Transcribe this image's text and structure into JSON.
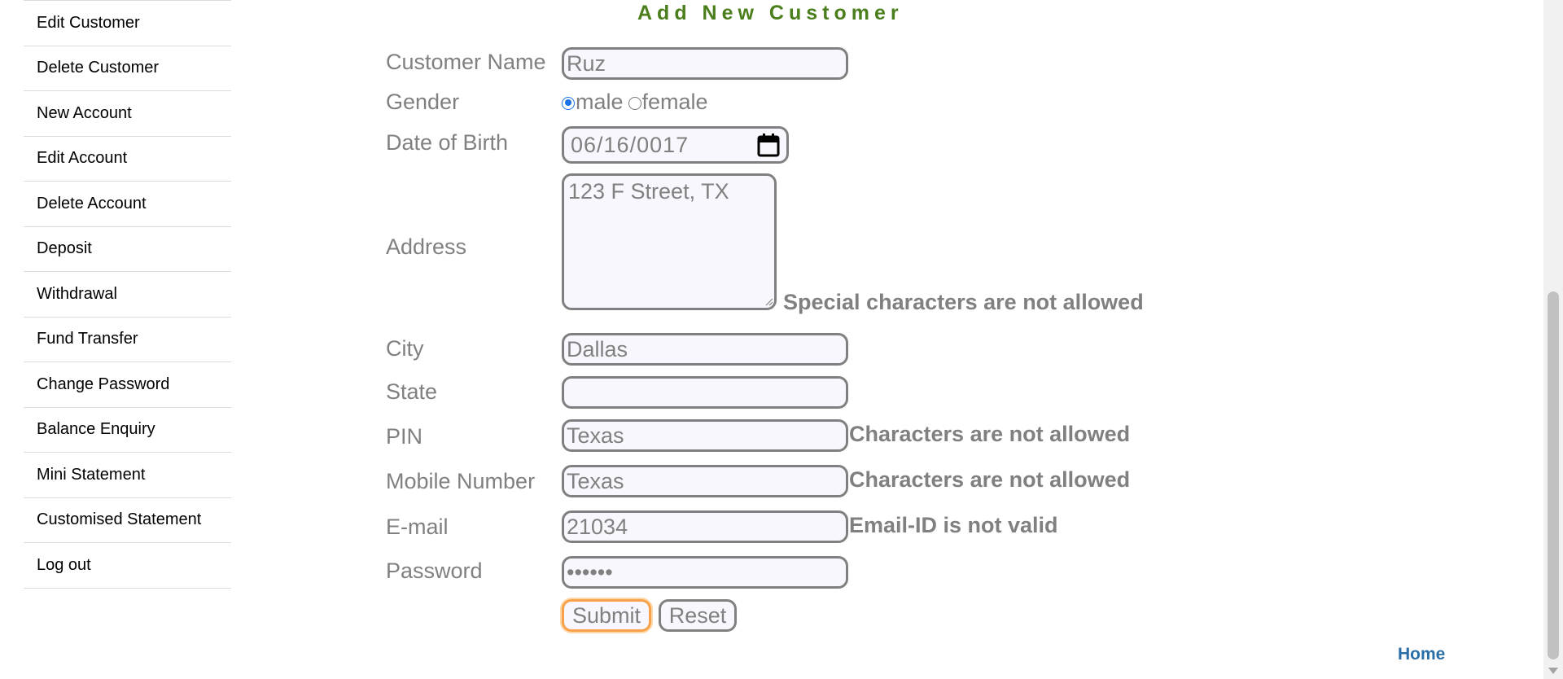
{
  "sidebar": {
    "items": [
      {
        "label": "Edit Customer"
      },
      {
        "label": "Delete Customer"
      },
      {
        "label": "New Account"
      },
      {
        "label": "Edit Account"
      },
      {
        "label": "Delete Account"
      },
      {
        "label": "Deposit"
      },
      {
        "label": "Withdrawal"
      },
      {
        "label": "Fund Transfer"
      },
      {
        "label": "Change Password"
      },
      {
        "label": "Balance Enquiry"
      },
      {
        "label": "Mini Statement"
      },
      {
        "label": "Customised Statement"
      },
      {
        "label": "Log out"
      }
    ]
  },
  "form": {
    "title": "Add New Customer",
    "fields": {
      "customer_name": {
        "label": "Customer Name",
        "value": "Ruz"
      },
      "gender": {
        "label": "Gender",
        "options": [
          "male",
          "female"
        ],
        "selected": "male"
      },
      "dob": {
        "label": "Date of Birth",
        "value": "06/16/0017"
      },
      "address": {
        "label": "Address",
        "value": "123 F Street, TX",
        "error": "Special characters are not allowed"
      },
      "city": {
        "label": "City",
        "value": "Dallas"
      },
      "state": {
        "label": "State",
        "value": ""
      },
      "pin": {
        "label": "PIN",
        "value": "Texas",
        "error": "Characters are not allowed"
      },
      "mobile": {
        "label": "Mobile Number",
        "value": "Texas",
        "error": "Characters are not allowed"
      },
      "email": {
        "label": "E-mail",
        "value": "21034",
        "error": "Email-ID is not valid"
      },
      "password": {
        "label": "Password",
        "value": "••••••"
      }
    },
    "buttons": {
      "submit_label": "Submit",
      "reset_label": "Reset"
    }
  },
  "footer": {
    "home_link": "Home"
  },
  "icons": {
    "calendar": "calendar-icon"
  },
  "colors": {
    "title": "#4b7e1c",
    "label": "#808080",
    "link": "#2a6fa8",
    "submit_focus": "#f7a24b",
    "radio_selected": "#1a73e8"
  }
}
